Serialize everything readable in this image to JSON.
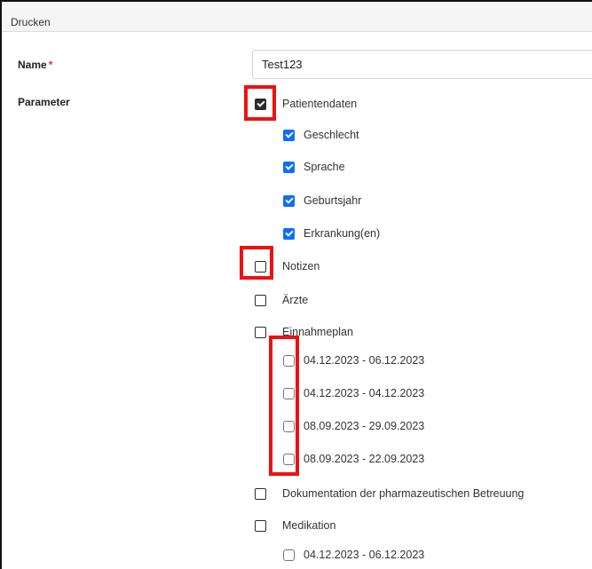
{
  "dialog": {
    "title": "Drucken"
  },
  "form": {
    "name_label": "Name",
    "required_mark": "*",
    "name_value": "Test123",
    "parameter_label": "Parameter"
  },
  "params": {
    "patientendaten": {
      "label": "Patientendaten",
      "checked": true
    },
    "patient_sub": [
      {
        "label": "Geschlecht",
        "checked": true
      },
      {
        "label": "Sprache",
        "checked": true
      },
      {
        "label": "Geburtsjahr",
        "checked": true
      },
      {
        "label": "Erkrankung(en)",
        "checked": true
      }
    ],
    "notizen": {
      "label": "Notizen",
      "checked": false
    },
    "aerzte": {
      "label": "Ärzte",
      "checked": false
    },
    "einnahmeplan": {
      "label": "Einnahmeplan",
      "checked": false
    },
    "einnahmeplan_sub": [
      {
        "label": "04.12.2023 - 06.12.2023",
        "checked": false
      },
      {
        "label": "04.12.2023 - 04.12.2023",
        "checked": false
      },
      {
        "label": "08.09.2023 - 29.09.2023",
        "checked": false
      },
      {
        "label": "08.09.2023 - 22.09.2023",
        "checked": false
      }
    ],
    "dokumentation": {
      "label": "Dokumentation der pharmazeutischen Betreuung",
      "checked": false
    },
    "medikation": {
      "label": "Medikation",
      "checked": false
    },
    "medikation_sub": [
      {
        "label": "04.12.2023 - 06.12.2023",
        "checked": false
      }
    ]
  },
  "colors": {
    "highlight": "#ee1111",
    "checkbox_blue": "#0d6efd",
    "required": "#d9363e"
  }
}
